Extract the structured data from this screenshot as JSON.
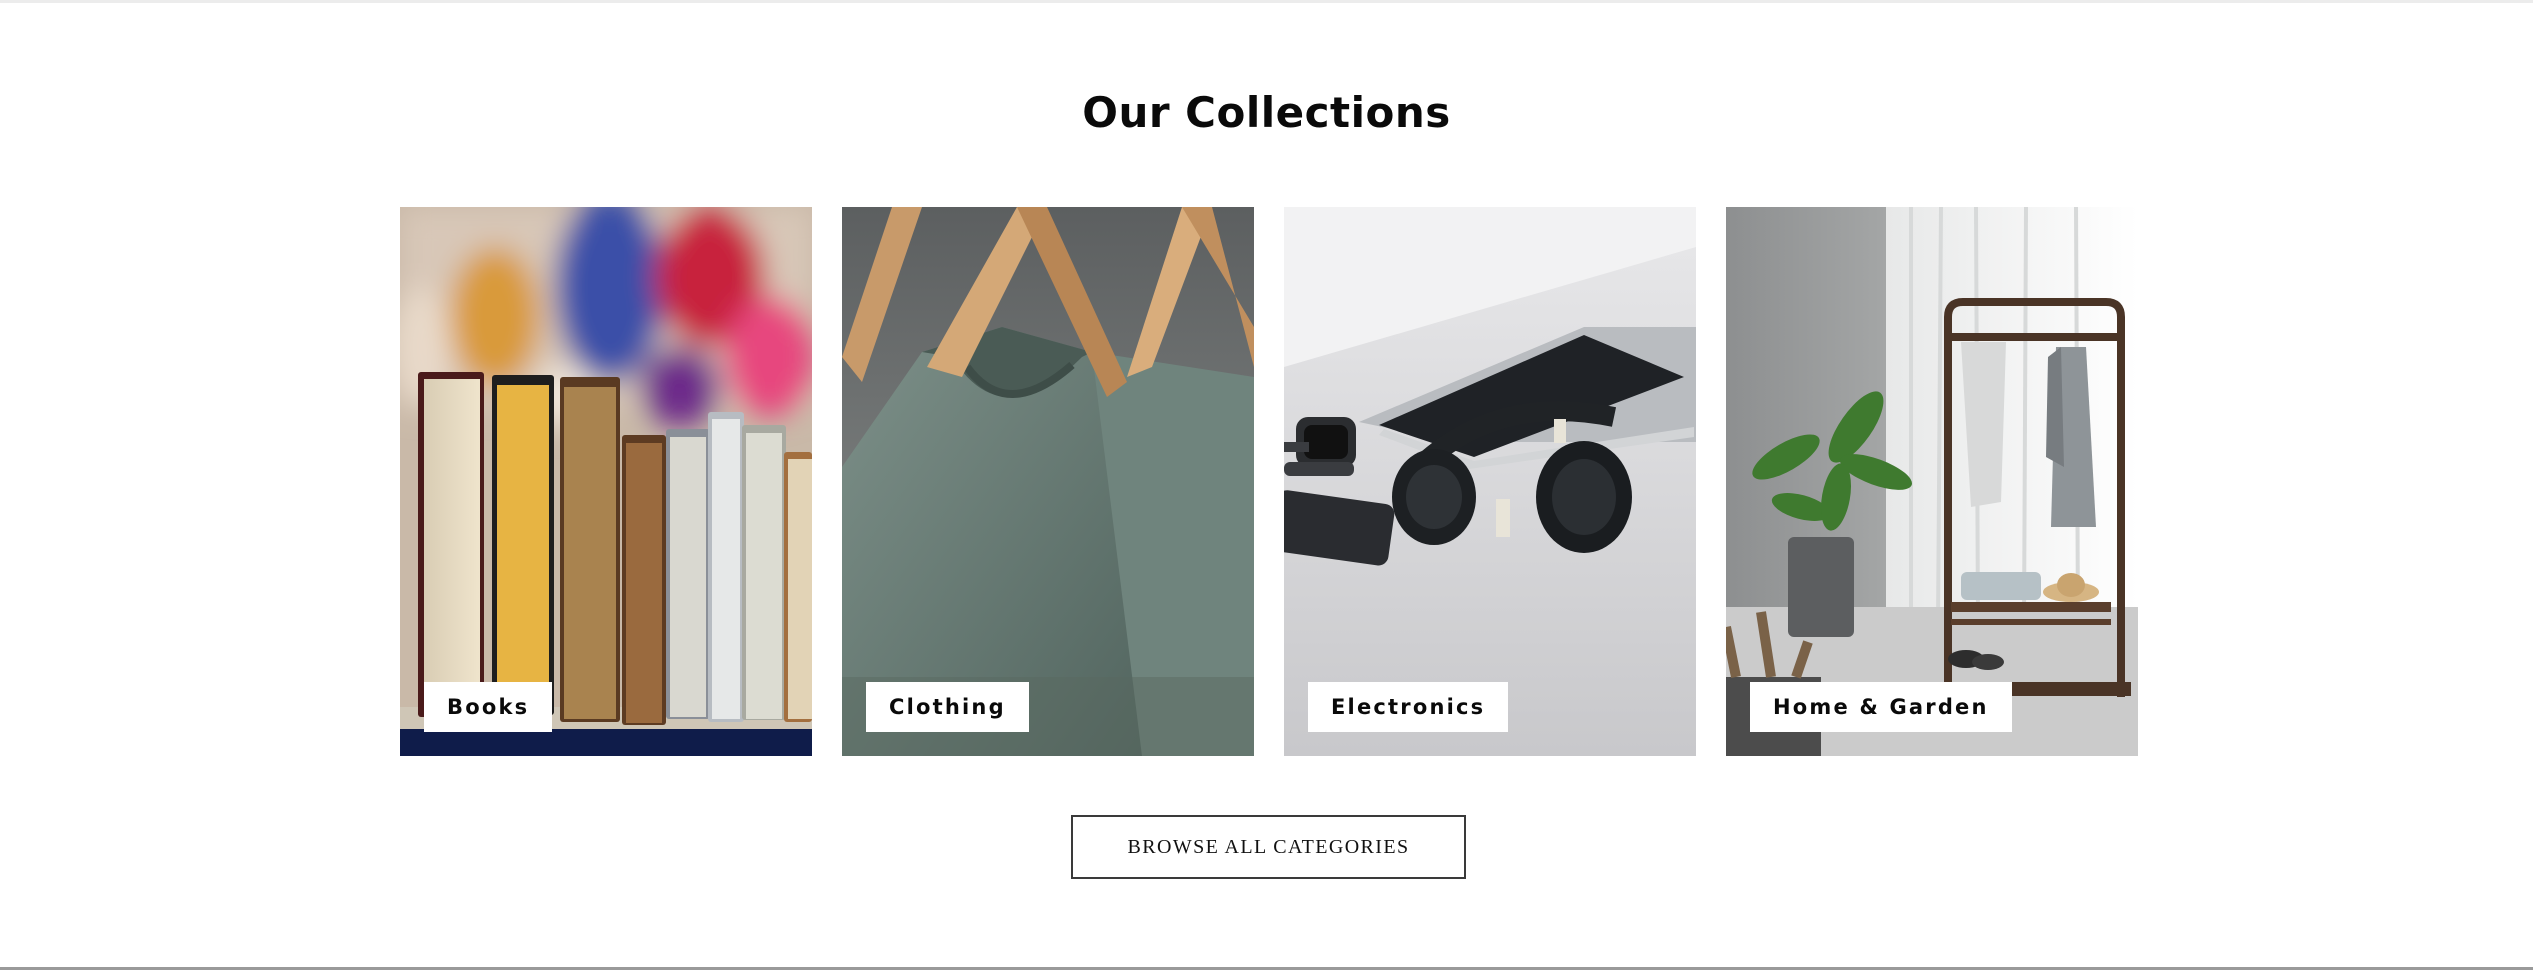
{
  "section": {
    "title": "Our Collections"
  },
  "collections": [
    {
      "label": "Books",
      "image": "books-photo"
    },
    {
      "label": "Clothing",
      "image": "clothing-photo"
    },
    {
      "label": "Electronics",
      "image": "electronics-photo"
    },
    {
      "label": "Home & Garden",
      "image": "home-garden-photo"
    }
  ],
  "browse_button": {
    "label": "BROWSE ALL CATEGORIES"
  }
}
